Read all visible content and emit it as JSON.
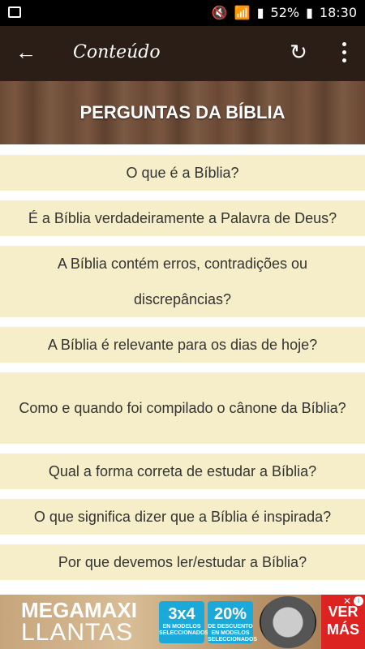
{
  "status": {
    "battery": "52%",
    "time": "18:30"
  },
  "appbar": {
    "title": "Conteúdo"
  },
  "hero": {
    "title": "PERGUNTAS DA BÍBLIA"
  },
  "items": [
    {
      "label": "O que é a Bíblia?"
    },
    {
      "label": "É a Bíblia verdadeiramente a Palavra de Deus?"
    },
    {
      "label": "A Bíblia contém erros, contradições ou discrepâncias?"
    },
    {
      "label": "A Bíblia é relevante para os dias de hoje?"
    },
    {
      "label": "Como e quando foi compilado o cânone da Bíblia?"
    },
    {
      "label": "Qual a forma correta de estudar a Bíblia?"
    },
    {
      "label": "O que significa dizer que a Bíblia é inspirada?"
    },
    {
      "label": "Por que devemos ler/estudar a Bíblia?"
    }
  ],
  "ad": {
    "brand_line1": "MEGAMAXI",
    "brand_line2": "LLANTAS",
    "promo1_big": "3x4",
    "promo1_small": "EN MODELOS SELECCIONADOS",
    "promo2_big": "20%",
    "promo2_small": "DE DESCUENTO EN MODELOS SELECCIONADOS",
    "cta": "VER MÁS"
  },
  "colors": {
    "appbar": "#2a1e16",
    "card": "#f6eec8",
    "text": "#333333"
  }
}
